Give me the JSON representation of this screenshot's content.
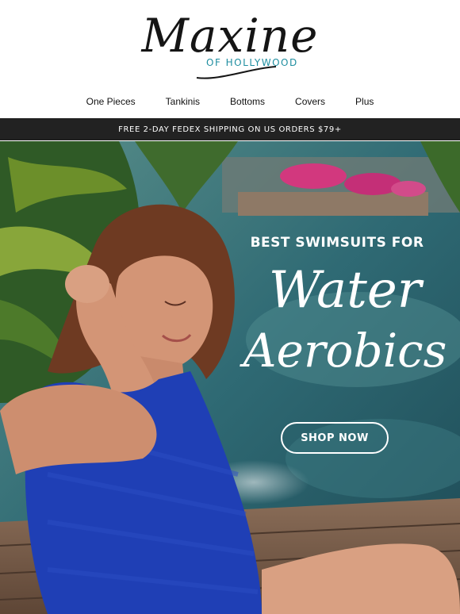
{
  "brand": {
    "name": "Maxine",
    "subtitle": "OF HOLLYWOOD"
  },
  "nav": {
    "items": [
      {
        "label": "One Pieces"
      },
      {
        "label": "Tankinis"
      },
      {
        "label": "Bottoms"
      },
      {
        "label": "Covers"
      },
      {
        "label": "Plus"
      }
    ]
  },
  "promo_banner": {
    "text": "FREE 2-DAY FEDEX SHIPPING ON US ORDERS $79+"
  },
  "hero": {
    "eyebrow": "BEST SWIMSUITS FOR",
    "script_line1": "Water",
    "script_line2": "Aerobics",
    "cta_label": "SHOP NOW"
  },
  "colors": {
    "brand_teal": "#1f8ea0",
    "banner_bg": "#222222",
    "swimsuit_blue": "#1f3fb5"
  }
}
